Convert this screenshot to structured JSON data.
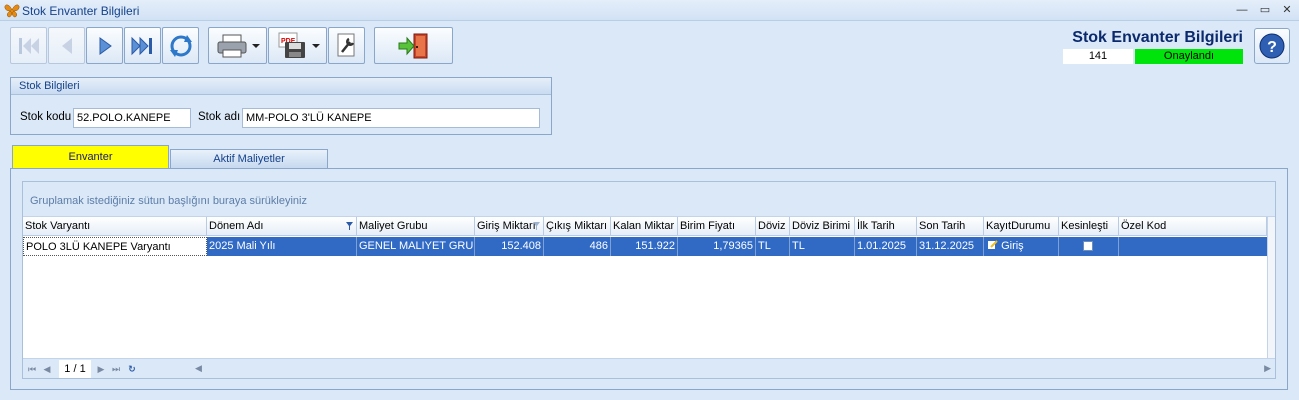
{
  "window": {
    "title": "Stok Envanter Bilgileri"
  },
  "header": {
    "title": "Stok Envanter Bilgileri",
    "count": "141",
    "status": "Onaylandı",
    "status_color": "#00e40b"
  },
  "stok_group": {
    "title": "Stok Bilgileri",
    "stok_kodu_label": "Stok kodu",
    "stok_kodu_value": "52.POLO.KANEPE",
    "stok_adi_label": "Stok adı",
    "stok_adi_value": "MM-POLO 3'LÜ KANEPE"
  },
  "tabs": [
    {
      "label": "Envanter",
      "active": true
    },
    {
      "label": "Aktif Maliyetler",
      "active": false
    }
  ],
  "grid": {
    "group_hint": "Gruplamak istediğiniz sütun başlığını buraya sürükleyiniz",
    "columns": [
      "Stok Varyantı",
      "Dönem Adı",
      "Maliyet Grubu",
      "Giriş Miktarı",
      "Çıkış Miktarı",
      "Kalan Miktar",
      "Birim Fiyatı",
      "Döviz",
      "Döviz Birimi",
      "İlk Tarih",
      "Son Tarih",
      "KayıtDurumu",
      "Kesinleşti",
      "Özel Kod"
    ],
    "rows": [
      [
        "POLO 3LÜ KANEPE Varyantı",
        "2025 Mali Yılı",
        "GENEL MALIYET GRUBU",
        "152.408",
        "486",
        "151.922",
        "1,79365",
        "TL",
        "TL",
        "1.01.2025",
        "31.12.2025",
        "Giriş",
        "",
        ""
      ]
    ],
    "pager": "1 / 1"
  }
}
